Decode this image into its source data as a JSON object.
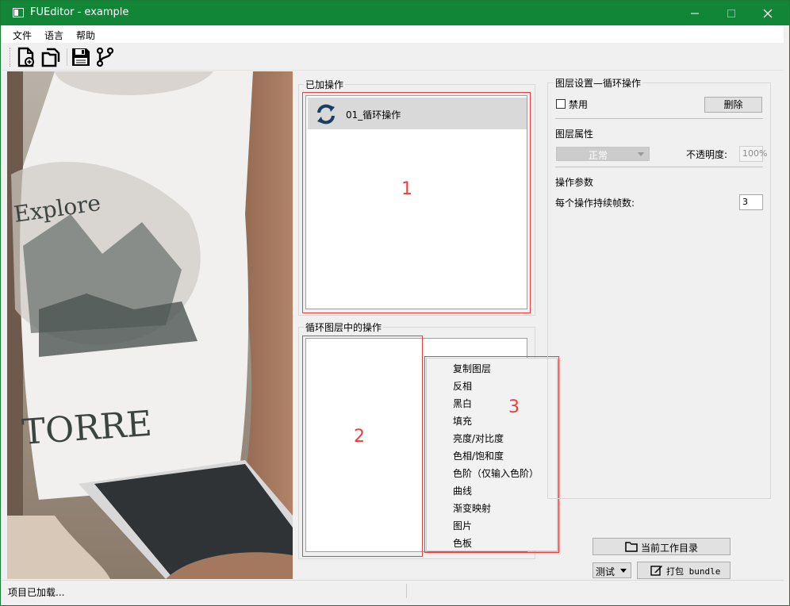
{
  "window": {
    "title": "FUEditor - example"
  },
  "menu": {
    "file": "文件",
    "language": "语言",
    "help": "帮助"
  },
  "toolbar": {
    "items": [
      "new-project-icon",
      "open-folder-icon",
      "save-icon",
      "branch-icon"
    ]
  },
  "added_ops": {
    "title": "已加操作",
    "items": [
      {
        "label": "01_循环操作",
        "icon": "refresh-icon"
      }
    ],
    "annotation": "1"
  },
  "loop_ops": {
    "title": "循环图层中的操作",
    "annotation": "2"
  },
  "context_menu": {
    "annotation": "3",
    "items": [
      "复制图层",
      "反相",
      "黑白",
      "填充",
      "亮度/对比度",
      "色相/饱和度",
      "色阶（仅输入色阶）",
      "曲线",
      "渐变映射",
      "图片",
      "色板"
    ]
  },
  "layer_settings": {
    "title": "图层设置—循环操作",
    "disable_label": "禁用",
    "disable_checked": false,
    "delete_button": "删除",
    "props_title": "图层属性",
    "blend_mode": "正常",
    "opacity_label": "不透明度:",
    "opacity_value": "100%",
    "params_title": "操作参数",
    "frames_label": "每个操作持续帧数:",
    "frames_value": "3"
  },
  "bottom": {
    "workdir_button": "当前工作目录",
    "mode_select": "测试",
    "pack_button": "打包 bundle"
  },
  "status": {
    "text": "项目已加载..."
  },
  "colors": {
    "titlebar": "#108636",
    "annotation": "#e8403f"
  }
}
